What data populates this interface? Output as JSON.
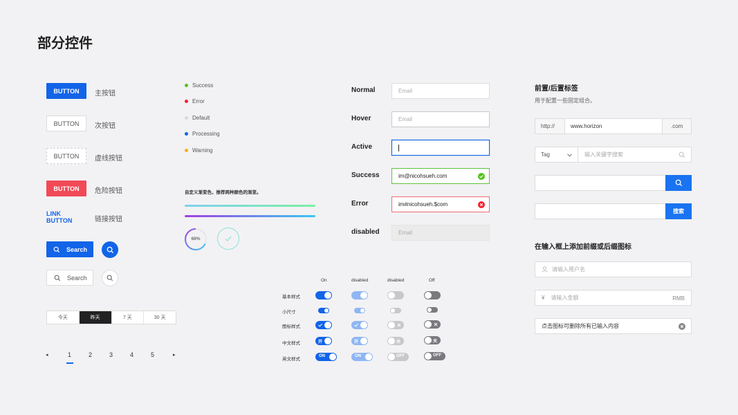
{
  "page": {
    "title": "部分控件"
  },
  "buttons": {
    "primary": {
      "label": "BUTTON",
      "caption": "主按钮"
    },
    "secondary": {
      "label": "BUTTON",
      "caption": "次按钮"
    },
    "dashed": {
      "label": "BUTTON",
      "caption": "虚线按钮"
    },
    "danger": {
      "label": "BUTTON",
      "caption": "危险按钮"
    },
    "link": {
      "label": "LINK BUTTON",
      "caption": "链接按钮"
    },
    "search_primary": {
      "label": "Search"
    },
    "search_default": {
      "label": "Search"
    }
  },
  "segmented": {
    "items": [
      "今天",
      "昨天",
      "7 天",
      "30 天"
    ],
    "selected": "昨天"
  },
  "pagination": {
    "prev": "◂",
    "pages": [
      "1",
      "2",
      "3",
      "4",
      "5"
    ],
    "current": "1",
    "next": "▸"
  },
  "statuses": [
    {
      "label": "Success",
      "color": "#52c41a"
    },
    {
      "label": "Error",
      "color": "#f5222d"
    },
    {
      "label": "Default",
      "color": "#d9d9d9"
    },
    {
      "label": "Processing",
      "color": "#1264e8"
    },
    {
      "label": "Warning",
      "color": "#faad14"
    }
  ],
  "gradient": {
    "caption": "自定义渐变色，推荐两种颜色的渐变。",
    "bar1": [
      "#7ed0f0",
      "#7af0a0"
    ],
    "bar2": [
      "#a040e0",
      "#38c8f0"
    ]
  },
  "progress": {
    "percent_label": "68%",
    "percent": 0.68
  },
  "inputs": {
    "normal": {
      "label": "Normal",
      "placeholder": "Email"
    },
    "hover": {
      "label": "Hover",
      "placeholder": "Email"
    },
    "active": {
      "label": "Active",
      "value": ""
    },
    "success": {
      "label": "Success",
      "value": "im@nicohsueh.com"
    },
    "error": {
      "label": "Error",
      "value": "im#nicohsueh.$com"
    },
    "disabled": {
      "label": "disabled",
      "placeholder": "Email"
    }
  },
  "switches": {
    "columns": [
      "On",
      "disabled",
      "disabled",
      "Off"
    ],
    "rows": [
      "基本样式",
      "小尺寸",
      "图标样式",
      "中文样式",
      "英文样式"
    ],
    "cn_on": "开",
    "cn_off": "关",
    "en_on": "ON",
    "en_off": "OFF"
  },
  "addons": {
    "title": "前置/后置标签",
    "subtitle": "用于配置一些固定组合。",
    "url_prefix": "http://",
    "url_value": "www.horizon",
    "url_suffix": ".com",
    "tag_select": "Tag",
    "keyword_placeholder": "输入关键字搜索",
    "search_button": "搜索"
  },
  "affix": {
    "title": "在输入框上添加前缀或后缀图标",
    "username_placeholder": "请输入用户名",
    "currency_symbol": "¥",
    "amount_placeholder": "请输入金额",
    "amount_suffix": "RMB",
    "clearable_value": "点击图标可删除所有已输入内容"
  }
}
